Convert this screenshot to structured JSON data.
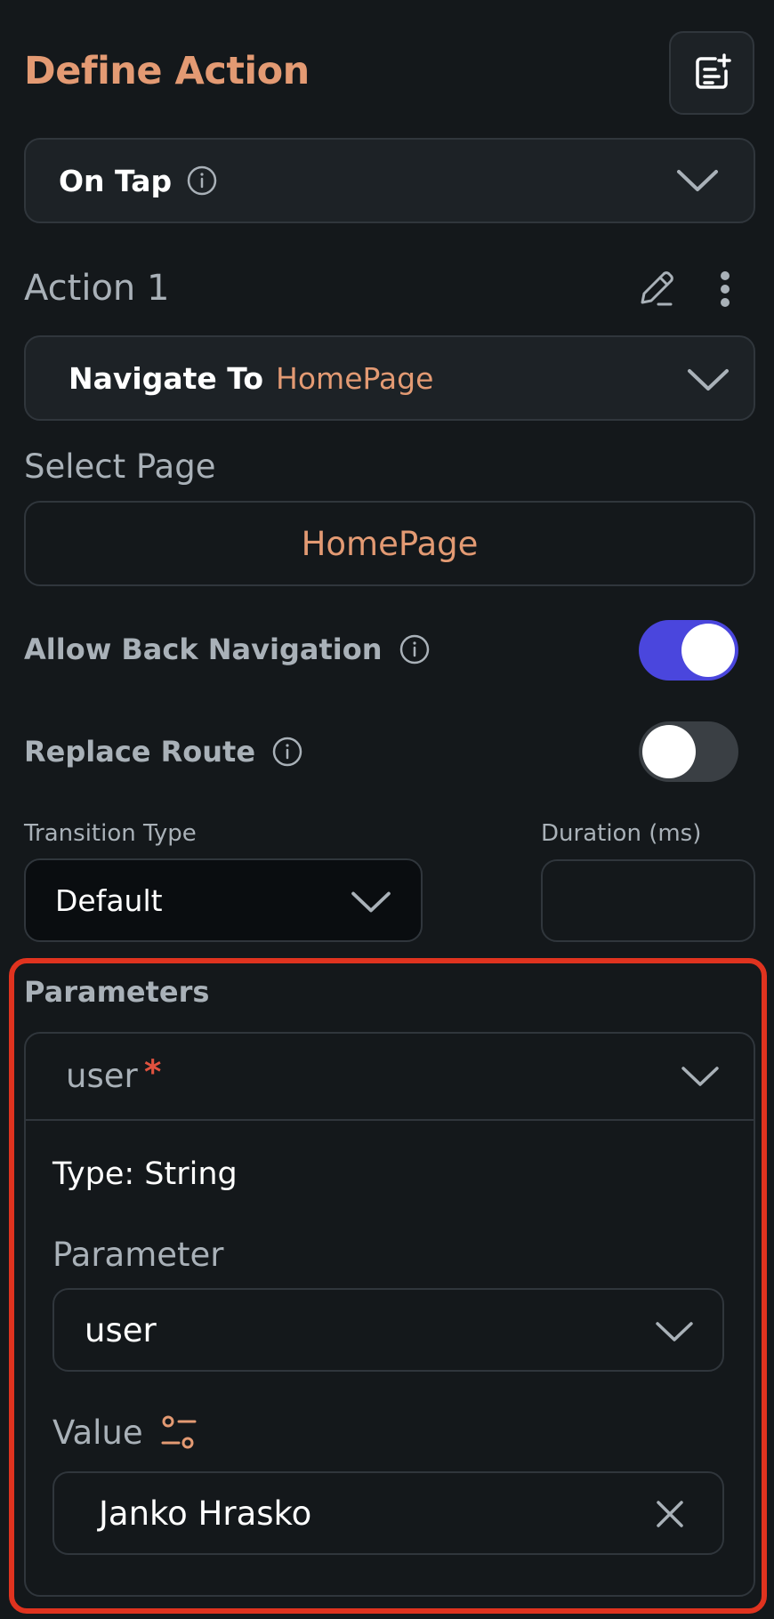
{
  "header": {
    "title": "Define Action",
    "add_icon": "add-note-icon"
  },
  "trigger": {
    "label": "On Tap",
    "info_icon": "info-icon"
  },
  "action": {
    "title": "Action 1",
    "edit_icon": "pencil-icon",
    "more_icon": "more-vertical-icon",
    "type_label": "Navigate To",
    "type_value": "HomePage"
  },
  "select_page": {
    "label": "Select Page",
    "value": "HomePage"
  },
  "allow_back": {
    "label": "Allow Back Navigation",
    "enabled": true
  },
  "replace_route": {
    "label": "Replace Route",
    "enabled": false
  },
  "transition": {
    "label": "Transition Type",
    "value": "Default"
  },
  "duration": {
    "label": "Duration (ms)",
    "value": ""
  },
  "parameters": {
    "title": "Parameters",
    "name": "user",
    "required_mark": "*",
    "type_text": "Type: String",
    "parameter_label": "Parameter",
    "parameter_value": "user",
    "value_label": "Value",
    "value_icon": "variable-settings-icon",
    "value": "Janko Hrasko",
    "clear_icon": "close-icon"
  },
  "colors": {
    "accent": "#e39a73",
    "toggle_on": "#4a46dd",
    "toggle_off": "#3a3f44",
    "highlight": "#e0331f",
    "required": "#e0523f"
  }
}
